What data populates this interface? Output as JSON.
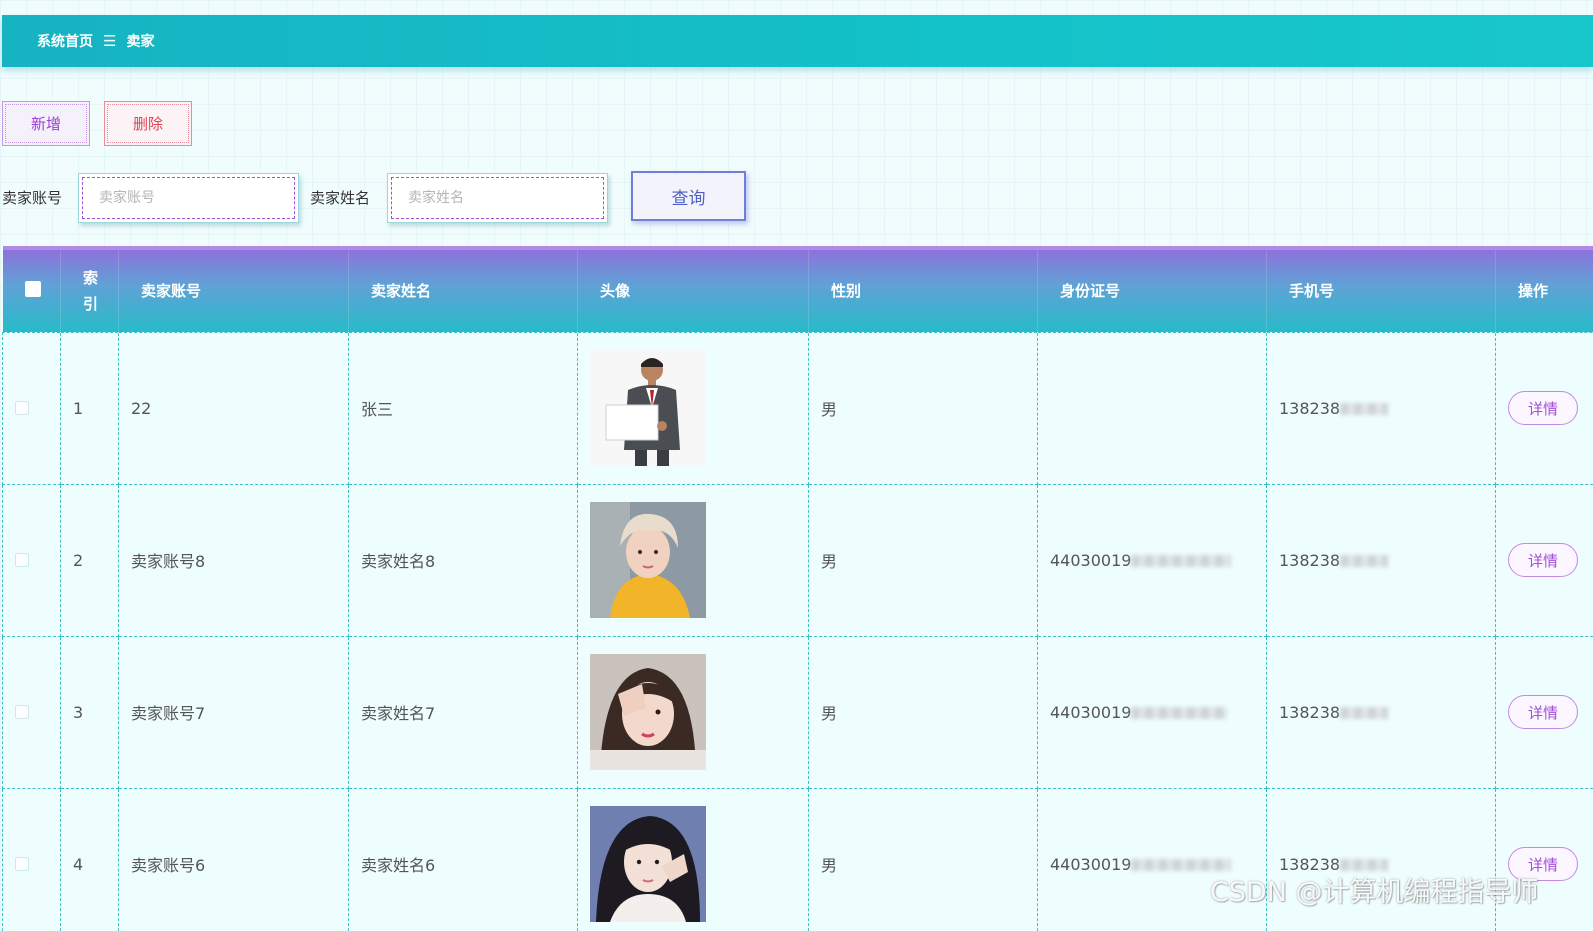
{
  "breadcrumb": {
    "home": "系统首页",
    "separator": "☰",
    "current": "卖家"
  },
  "actions": {
    "add_label": "新增",
    "delete_label": "删除"
  },
  "search": {
    "account_label": "卖家账号",
    "account_placeholder": "卖家账号",
    "name_label": "卖家姓名",
    "name_placeholder": "卖家姓名",
    "query_label": "查询"
  },
  "table": {
    "headers": {
      "index": "索引",
      "account": "卖家账号",
      "name": "卖家姓名",
      "avatar": "头像",
      "gender": "性别",
      "id_card": "身份证号",
      "phone": "手机号",
      "action": "操作"
    },
    "rows": [
      {
        "index": "1",
        "account": "22",
        "name": "张三",
        "avatar": "avatar-businessman",
        "gender": "男",
        "id_card": "",
        "phone": "138238",
        "action": "详情"
      },
      {
        "index": "2",
        "account": "卖家账号8",
        "name": "卖家姓名8",
        "avatar": "avatar-yellow-shirt",
        "gender": "男",
        "id_card": "44030019",
        "phone": "138238",
        "action": "详情"
      },
      {
        "index": "3",
        "account": "卖家账号7",
        "name": "卖家姓名7",
        "avatar": "avatar-salute",
        "gender": "男",
        "id_card": "44030019",
        "phone": "138238",
        "action": "详情"
      },
      {
        "index": "4",
        "account": "卖家账号6",
        "name": "卖家姓名6",
        "avatar": "avatar-pose",
        "gender": "男",
        "id_card": "44030019",
        "phone": "138238",
        "action": "详情"
      }
    ]
  },
  "watermark": "CSDN @计算机编程指导师",
  "colors": {
    "breadcrumb_bg": "#14c2c9",
    "header_gradient_top": "#8f6fda",
    "header_gradient_bottom": "#27bbc8",
    "add_button": "#9a3fd0",
    "delete_button": "#e04353",
    "query_button": "#4d5fc8",
    "detail_button": "#a050d2"
  }
}
